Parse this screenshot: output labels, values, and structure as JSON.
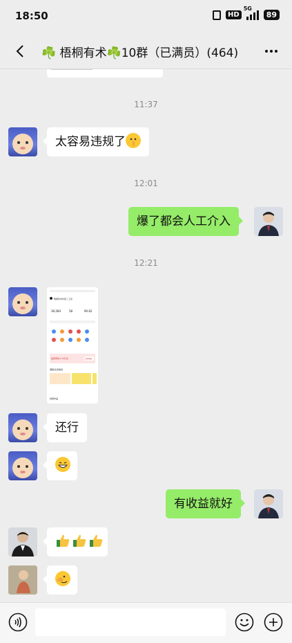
{
  "status": {
    "time": "18:50",
    "hd": "HD",
    "network": "5G",
    "battery": "89"
  },
  "nav": {
    "title": "☘️ 梧桐有术☘️10群（已满员）(464)"
  },
  "messages": {
    "t1": "11:37",
    "m1": "太容易违规了",
    "t2": "12:01",
    "m2": "爆了都会人工介入",
    "t3": "12:21",
    "m4": "还行",
    "m6": "有收益就好"
  },
  "screenshot": {
    "header": "梧桐有术抖音 | 工具",
    "stats": [
      "39,284",
      "58",
      "90.62"
    ],
    "banner": "免费申领 0.3元/次",
    "banner_btn": "立即领取",
    "section": "课程/任务精选",
    "tab": "视频作品"
  },
  "colors": {
    "sent_bubble": "#95ec69",
    "received_bubble": "#ffffff",
    "background": "#ededed"
  },
  "icons": [
    "back-icon",
    "more-icon",
    "voice-icon",
    "emoji-icon",
    "plus-icon"
  ]
}
